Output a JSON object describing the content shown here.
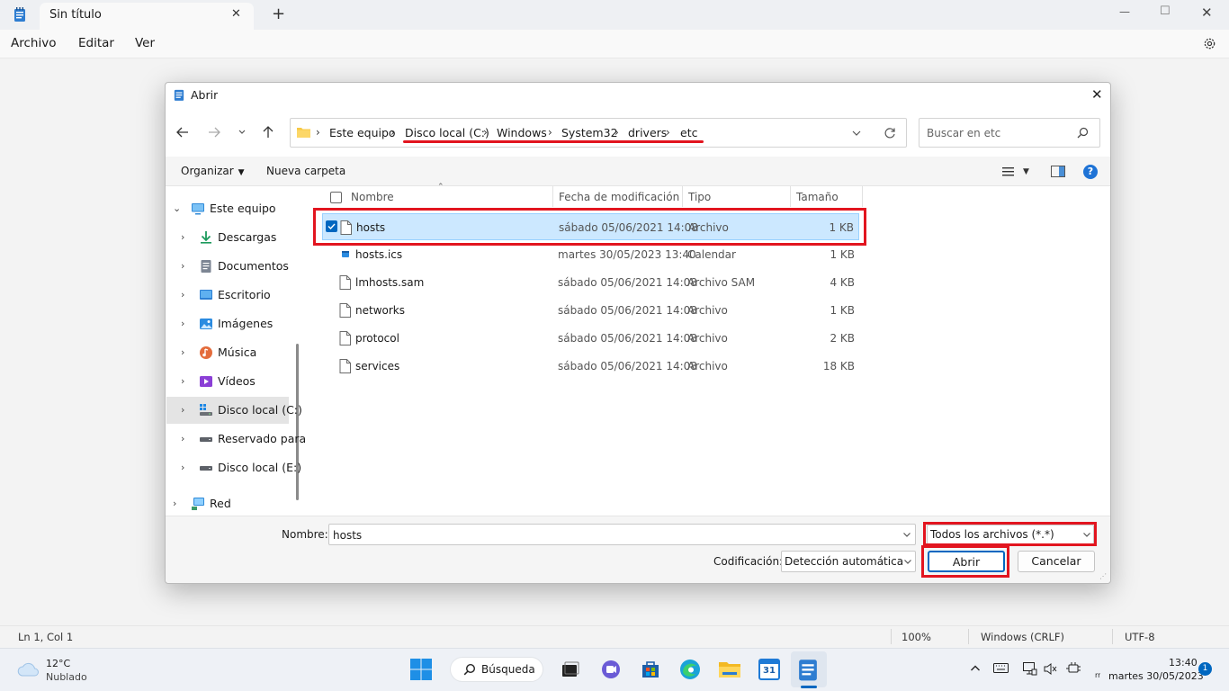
{
  "window": {
    "tab_title": "Sin título",
    "new_tab": "+",
    "minimize": "—",
    "maximize": "☐",
    "close": "✕"
  },
  "menu": [
    "Archivo",
    "Editar",
    "Ver"
  ],
  "status": {
    "position": "Ln 1, Col 1",
    "zoom": "100%",
    "line_ending": "Windows (CRLF)",
    "encoding": "UTF-8"
  },
  "dialog": {
    "title": "Abrir",
    "breadcrumb": [
      "Este equipo",
      "Disco local (C:)",
      "Windows",
      "System32",
      "drivers",
      "etc"
    ],
    "search_placeholder": "Buscar en etc",
    "organize": "Organizar",
    "new_folder": "Nueva carpeta",
    "nav": [
      {
        "label": "Este equipo",
        "icon": "pc-icon",
        "expanded": true
      },
      {
        "label": "Descargas",
        "icon": "download-icon"
      },
      {
        "label": "Documentos",
        "icon": "document-icon"
      },
      {
        "label": "Escritorio",
        "icon": "desktop-icon"
      },
      {
        "label": "Imágenes",
        "icon": "image-icon"
      },
      {
        "label": "Música",
        "icon": "music-icon"
      },
      {
        "label": "Vídeos",
        "icon": "video-icon"
      },
      {
        "label": "Disco local (C:)",
        "icon": "drive-c-icon",
        "selected": true
      },
      {
        "label": "Reservado para",
        "icon": "drive-icon"
      },
      {
        "label": "Disco local (E:)",
        "icon": "drive-icon"
      },
      {
        "label": "Red",
        "icon": "network-icon"
      }
    ],
    "columns": [
      "Nombre",
      "Fecha de modificación",
      "Tipo",
      "Tamaño"
    ],
    "files": [
      {
        "name": "hosts",
        "date": "sábado 05/06/2021 14:08",
        "type": "Archivo",
        "size": "1 KB",
        "selected": true
      },
      {
        "name": "hosts.ics",
        "date": "martes 30/05/2023 13:40",
        "type": "Calendar",
        "size": "1 KB"
      },
      {
        "name": "lmhosts.sam",
        "date": "sábado 05/06/2021 14:08",
        "type": "Archivo SAM",
        "size": "4 KB"
      },
      {
        "name": "networks",
        "date": "sábado 05/06/2021 14:08",
        "type": "Archivo",
        "size": "1 KB"
      },
      {
        "name": "protocol",
        "date": "sábado 05/06/2021 14:08",
        "type": "Archivo",
        "size": "2 KB"
      },
      {
        "name": "services",
        "date": "sábado 05/06/2021 14:08",
        "type": "Archivo",
        "size": "18 KB"
      }
    ],
    "filename_label": "Nombre:",
    "filename_value": "hosts",
    "filter": "Todos los archivos  (*.*)",
    "encoding_label": "Codificación:",
    "encoding_value": "Detección automática",
    "open_button": "Abrir",
    "cancel_button": "Cancelar",
    "accent": "#0067c0",
    "highlight": "#e2151f"
  },
  "taskbar": {
    "weather_temp": "12°C",
    "weather_desc": "Nublado",
    "search_label": "Búsqueda",
    "calendar_day": "31",
    "time": "13:40",
    "date": "martes 30/05/2023",
    "date_prefix": "rr",
    "notification_count": "1"
  }
}
